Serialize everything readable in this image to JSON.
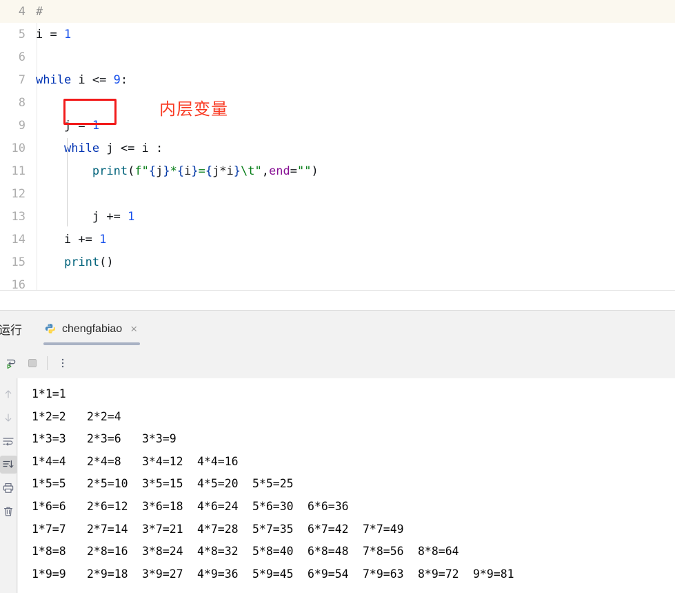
{
  "editor": {
    "lines": [
      {
        "number": "4",
        "active": true,
        "tokens": [
          {
            "t": "#",
            "c": "cmt"
          }
        ],
        "indent": 0
      },
      {
        "number": "5",
        "active": false,
        "tokens": [
          {
            "t": "i = ",
            "c": "plain"
          },
          {
            "t": "1",
            "c": "num"
          }
        ],
        "indent": 0
      },
      {
        "number": "6",
        "active": false,
        "tokens": [],
        "indent": 0
      },
      {
        "number": "7",
        "active": false,
        "tokens": [
          {
            "t": "while",
            "c": "kw"
          },
          {
            "t": " i <= ",
            "c": "plain"
          },
          {
            "t": "9",
            "c": "num"
          },
          {
            "t": ":",
            "c": "plain"
          }
        ],
        "indent": 0
      },
      {
        "number": "8",
        "active": false,
        "tokens": [],
        "indent": 0
      },
      {
        "number": "9",
        "active": false,
        "tokens": [
          {
            "t": "    j = ",
            "c": "plain"
          },
          {
            "t": "1",
            "c": "num"
          }
        ],
        "indent": 1
      },
      {
        "number": "10",
        "active": false,
        "tokens": [
          {
            "t": "    ",
            "c": "plain"
          },
          {
            "t": "while",
            "c": "kw"
          },
          {
            "t": " j <= i :",
            "c": "plain"
          }
        ],
        "indent": 1
      },
      {
        "number": "11",
        "active": false,
        "tokens": [
          {
            "t": "        ",
            "c": "plain"
          },
          {
            "t": "print",
            "c": "fn"
          },
          {
            "t": "(",
            "c": "plain"
          },
          {
            "t": "f\"",
            "c": "str"
          },
          {
            "t": "{",
            "c": "brace"
          },
          {
            "t": "j",
            "c": "inbrace"
          },
          {
            "t": "}",
            "c": "brace"
          },
          {
            "t": "*",
            "c": "str"
          },
          {
            "t": "{",
            "c": "brace"
          },
          {
            "t": "i",
            "c": "inbrace"
          },
          {
            "t": "}",
            "c": "brace"
          },
          {
            "t": "=",
            "c": "str"
          },
          {
            "t": "{",
            "c": "brace"
          },
          {
            "t": "j*i",
            "c": "inbrace"
          },
          {
            "t": "}",
            "c": "brace"
          },
          {
            "t": "\\t\"",
            "c": "str"
          },
          {
            "t": ",",
            "c": "plain"
          },
          {
            "t": "end",
            "c": "named"
          },
          {
            "t": "=",
            "c": "plain"
          },
          {
            "t": "\"\"",
            "c": "str"
          },
          {
            "t": ")",
            "c": "plain"
          }
        ],
        "indent": 2
      },
      {
        "number": "12",
        "active": false,
        "tokens": [],
        "indent": 2
      },
      {
        "number": "13",
        "active": false,
        "tokens": [
          {
            "t": "        j += ",
            "c": "plain"
          },
          {
            "t": "1",
            "c": "num"
          }
        ],
        "indent": 2
      },
      {
        "number": "14",
        "active": false,
        "tokens": [
          {
            "t": "    i += ",
            "c": "plain"
          },
          {
            "t": "1",
            "c": "num"
          }
        ],
        "indent": 1
      },
      {
        "number": "15",
        "active": false,
        "tokens": [
          {
            "t": "    ",
            "c": "plain"
          },
          {
            "t": "print",
            "c": "fn"
          },
          {
            "t": "()",
            "c": "plain"
          }
        ],
        "indent": 1
      },
      {
        "number": "16",
        "active": false,
        "tokens": [],
        "indent": 0
      }
    ],
    "annotation": {
      "note_text": "内层变量",
      "note_color": "#f93a23",
      "box_color": "#f21b1b",
      "boxed_code": "j = 1"
    }
  },
  "toolwindow": {
    "title": "运行",
    "tab": {
      "label": "chengfabiao",
      "icon": "python-icon",
      "close": "×"
    },
    "toolbar": [
      {
        "name": "rerun-button",
        "icon": "rerun-icon"
      },
      {
        "name": "stop-button",
        "icon": "stop-icon"
      },
      {
        "name": "more-options-button",
        "icon": "vertical-dots-icon"
      }
    ],
    "rail": [
      {
        "name": "up-button",
        "icon": "arrow-up-icon",
        "selected": false
      },
      {
        "name": "down-button",
        "icon": "arrow-down-icon",
        "selected": false
      },
      {
        "name": "soft-wrap-button",
        "icon": "soft-wrap-icon",
        "selected": false
      },
      {
        "name": "scroll-to-end-button",
        "icon": "scroll-to-end-icon",
        "selected": true
      },
      {
        "name": "print-button",
        "icon": "print-icon",
        "selected": false
      },
      {
        "name": "clear-all-button",
        "icon": "trash-icon",
        "selected": false
      }
    ],
    "console_output": [
      [
        "1*1=1"
      ],
      [
        "1*2=2",
        "2*2=4"
      ],
      [
        "1*3=3",
        "2*3=6",
        "3*3=9"
      ],
      [
        "1*4=4",
        "2*4=8",
        "3*4=12",
        "4*4=16"
      ],
      [
        "1*5=5",
        "2*5=10",
        "3*5=15",
        "4*5=20",
        "5*5=25"
      ],
      [
        "1*6=6",
        "2*6=12",
        "3*6=18",
        "4*6=24",
        "5*6=30",
        "6*6=36"
      ],
      [
        "1*7=7",
        "2*7=14",
        "3*7=21",
        "4*7=28",
        "5*7=35",
        "6*7=42",
        "7*7=49"
      ],
      [
        "1*8=8",
        "2*8=16",
        "3*8=24",
        "4*8=32",
        "5*8=40",
        "6*8=48",
        "7*8=56",
        "8*8=64"
      ],
      [
        "1*9=9",
        "2*9=18",
        "3*9=27",
        "4*9=36",
        "5*9=45",
        "6*9=54",
        "7*9=63",
        "8*9=72",
        "9*9=81"
      ]
    ]
  },
  "colors": {
    "keyword": "#0033b3",
    "number": "#1750eb",
    "string": "#067d17",
    "named_arg": "#871094",
    "comment": "#8c8c8c",
    "function": "#00627a",
    "caret_line_bg": "#fbf8ef",
    "tab_underline": "#a9b2c4",
    "annotation_red": "#f93a23"
  }
}
